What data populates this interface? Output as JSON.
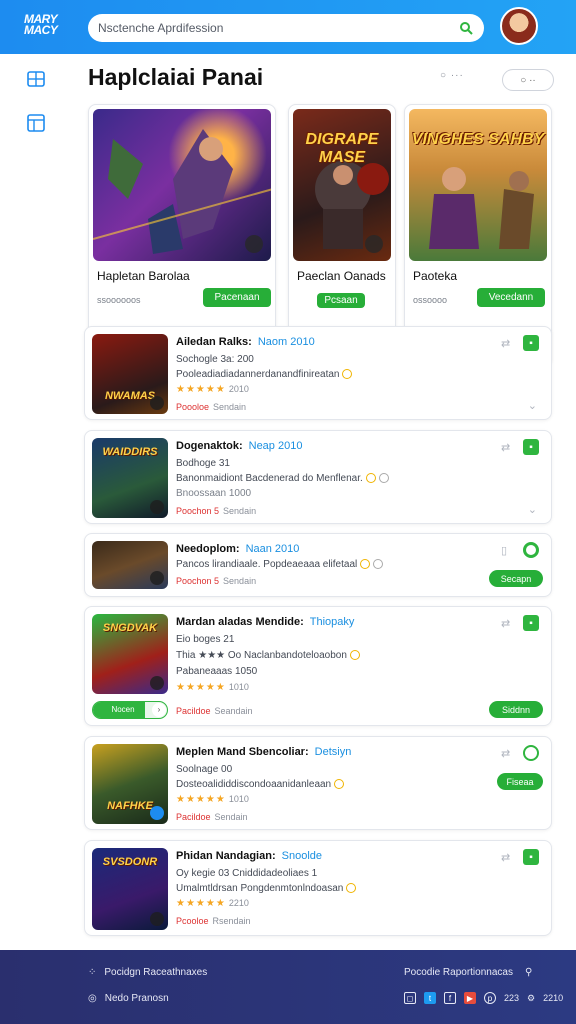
{
  "header": {
    "logo_text": "MARY MACY",
    "search_text": "Nsctenche Aprdifession",
    "colors": {
      "bar": "#1d8cf0",
      "accent_green": "#27ae38"
    }
  },
  "sidebar": {
    "items": [
      {
        "icon": "grid-icon"
      },
      {
        "icon": "table-icon"
      }
    ]
  },
  "main": {
    "title": "Haplclaiai Panai",
    "tools_dots": "○ ···",
    "toggle_label": "○ ··"
  },
  "featured": [
    {
      "art_text": "",
      "title": "Hapletan Barolaa",
      "meta": "ssoooooos",
      "button": "Pacenaan"
    },
    {
      "art_text": "DIGRAPE MASE",
      "title": "Paeclan Oanads",
      "meta": "",
      "button": "Pcsaan"
    },
    {
      "art_text": "VINGHES SAHBY",
      "title": "Paoteka",
      "meta": "ossoooo",
      "button": "Vecedann"
    }
  ],
  "rows": [
    {
      "thumb_text": "NWAMAS",
      "title": "Ailedan Ralks:",
      "tag": "Naom 2010",
      "line1": "Sochogle 3a: 200",
      "line2": "Pooleadiadiadannerdanandfinireatan",
      "stars": "★★★★★",
      "count": "2010",
      "price_old": "Poooloe",
      "price_new": "Sendain",
      "button": ""
    },
    {
      "thumb_text": "WAIDDIRS",
      "title": "Dogenaktok:",
      "tag": "Neap 2010",
      "line1": "Bodhoge 31",
      "line2": "Banonmaidiont Bacdenerad do Menflenar.",
      "line3": "Bnoossaan 1000",
      "price_old": "Poochon 5",
      "price_new": "Sendain",
      "button": ""
    },
    {
      "thumb_text": "",
      "title": "Needoplom:",
      "tag": "Naan 2010",
      "line1": "Pancos lirandiaale. Popdeaeaaa elifetaal",
      "price_old": "Poochon 5",
      "price_new": "Sendain",
      "button": "Secapn"
    },
    {
      "thumb_text": "SNGDVAK",
      "title": "Mardan aladas  Mendide:",
      "tag": "Thiopaky",
      "line1": "Eio boges 21",
      "line2": "Thia ★★★ Oo Naclanbandoteloaobon",
      "line3": "Pabaneaaas 1050",
      "stars": "★★★★★",
      "count": "1010",
      "price_old": "Pacildoe",
      "price_new": "Seandain",
      "progress_label": "Nocen",
      "progress": 0.7,
      "button": "Siddnn"
    },
    {
      "thumb_text": "NAFHKE",
      "title": "Meplen Mand Sbencoliar:",
      "tag": "Detsiyn",
      "line1": "Soolnage 00",
      "line2": "Dosteoalididdiscondoaanidanleaan",
      "stars": "★★★★★",
      "count": "1010",
      "price_old": "Pacildoe",
      "price_new": "Sendain",
      "button": "Fiseaa"
    },
    {
      "thumb_text": "SVSDONR",
      "title": "Phidan Nandagian:",
      "tag": "Snoolde",
      "line1": "Oy kegie 03 Cniddidadeoliaes 1",
      "line2": "Umalmtldrsan Pongdenmtonlndoasan",
      "stars": "★★★★★",
      "count": "2210",
      "price_old": "Pcooloe",
      "price_new": "Rsendain",
      "button": ""
    }
  ],
  "footer": {
    "left1": "Pocidgn Raceathnaxes",
    "left2": "Nedo Pranosn",
    "right1": "Pocodie Raportionnacas",
    "social_tail": "223",
    "social_end": "2210"
  }
}
